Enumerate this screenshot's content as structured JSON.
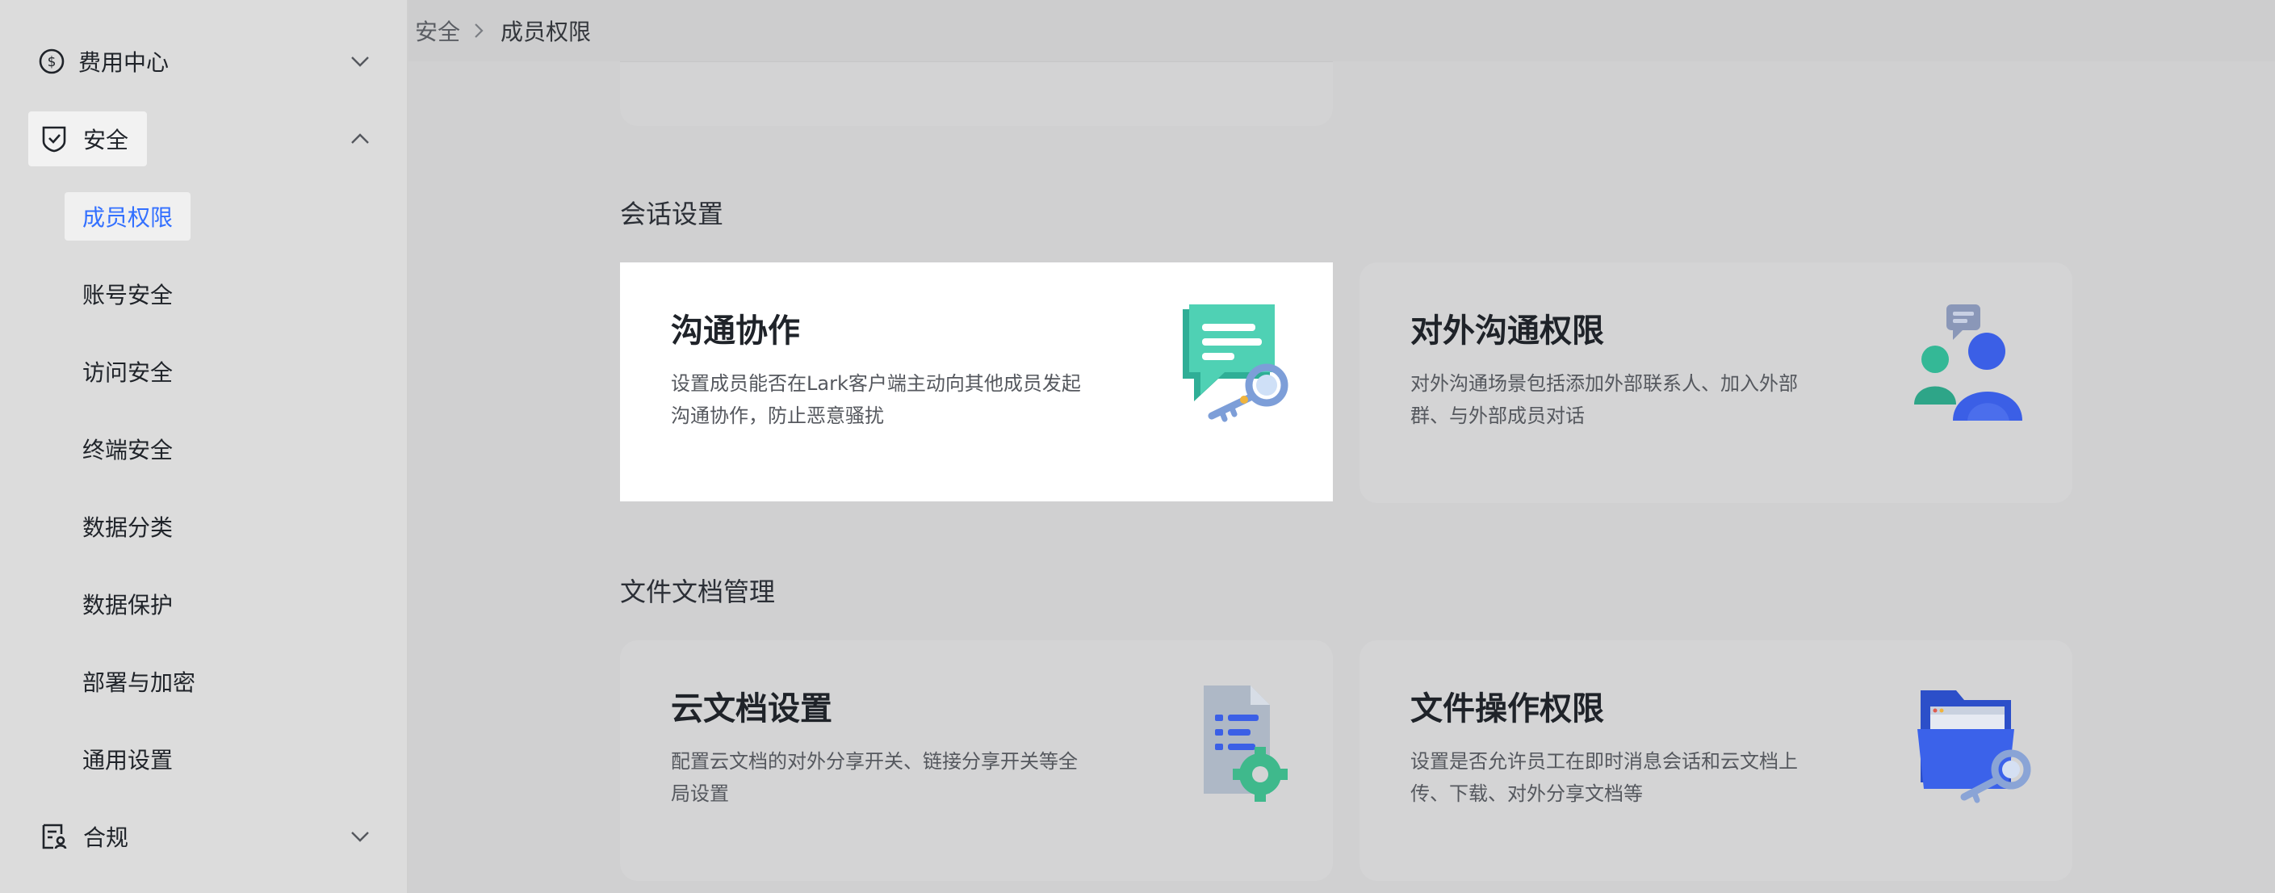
{
  "sidebar": {
    "groups": [
      {
        "label": "费用中心",
        "icon": "dollar-icon",
        "expanded": false
      },
      {
        "label": "安全",
        "icon": "shield-icon",
        "expanded": true
      },
      {
        "label": "合规",
        "icon": "compliance-icon",
        "expanded": false
      }
    ],
    "security_items": [
      {
        "label": "成员权限",
        "active": true
      },
      {
        "label": "账号安全"
      },
      {
        "label": "访问安全"
      },
      {
        "label": "终端安全"
      },
      {
        "label": "数据分类"
      },
      {
        "label": "数据保护"
      },
      {
        "label": "部署与加密"
      },
      {
        "label": "通用设置"
      }
    ]
  },
  "breadcrumb": {
    "parent": "安全",
    "current": "成员权限"
  },
  "sections": [
    {
      "title": "会话设置",
      "cards": [
        {
          "title": "沟通协作",
          "desc": "设置成员能否在Lark客户端主动向其他成员发起沟通协作，防止恶意骚扰",
          "icon": "chat-key-icon"
        },
        {
          "title": "对外沟通权限",
          "desc": "对外沟通场景包括添加外部联系人、加入外部群、与外部成员对话",
          "icon": "external-users-icon"
        }
      ]
    },
    {
      "title": "文件文档管理",
      "cards": [
        {
          "title": "云文档设置",
          "desc": "配置云文档的对外分享开关、链接分享开关等全局设置",
          "icon": "doc-gear-icon"
        },
        {
          "title": "文件操作权限",
          "desc": "设置是否允许员工在即时消息会话和云文档上传、下载、对外分享文档等",
          "icon": "folder-key-icon"
        }
      ]
    }
  ],
  "colors": {
    "accent": "#3370ff",
    "teal": "#3ec3a5",
    "blue": "#3a5ee8"
  }
}
